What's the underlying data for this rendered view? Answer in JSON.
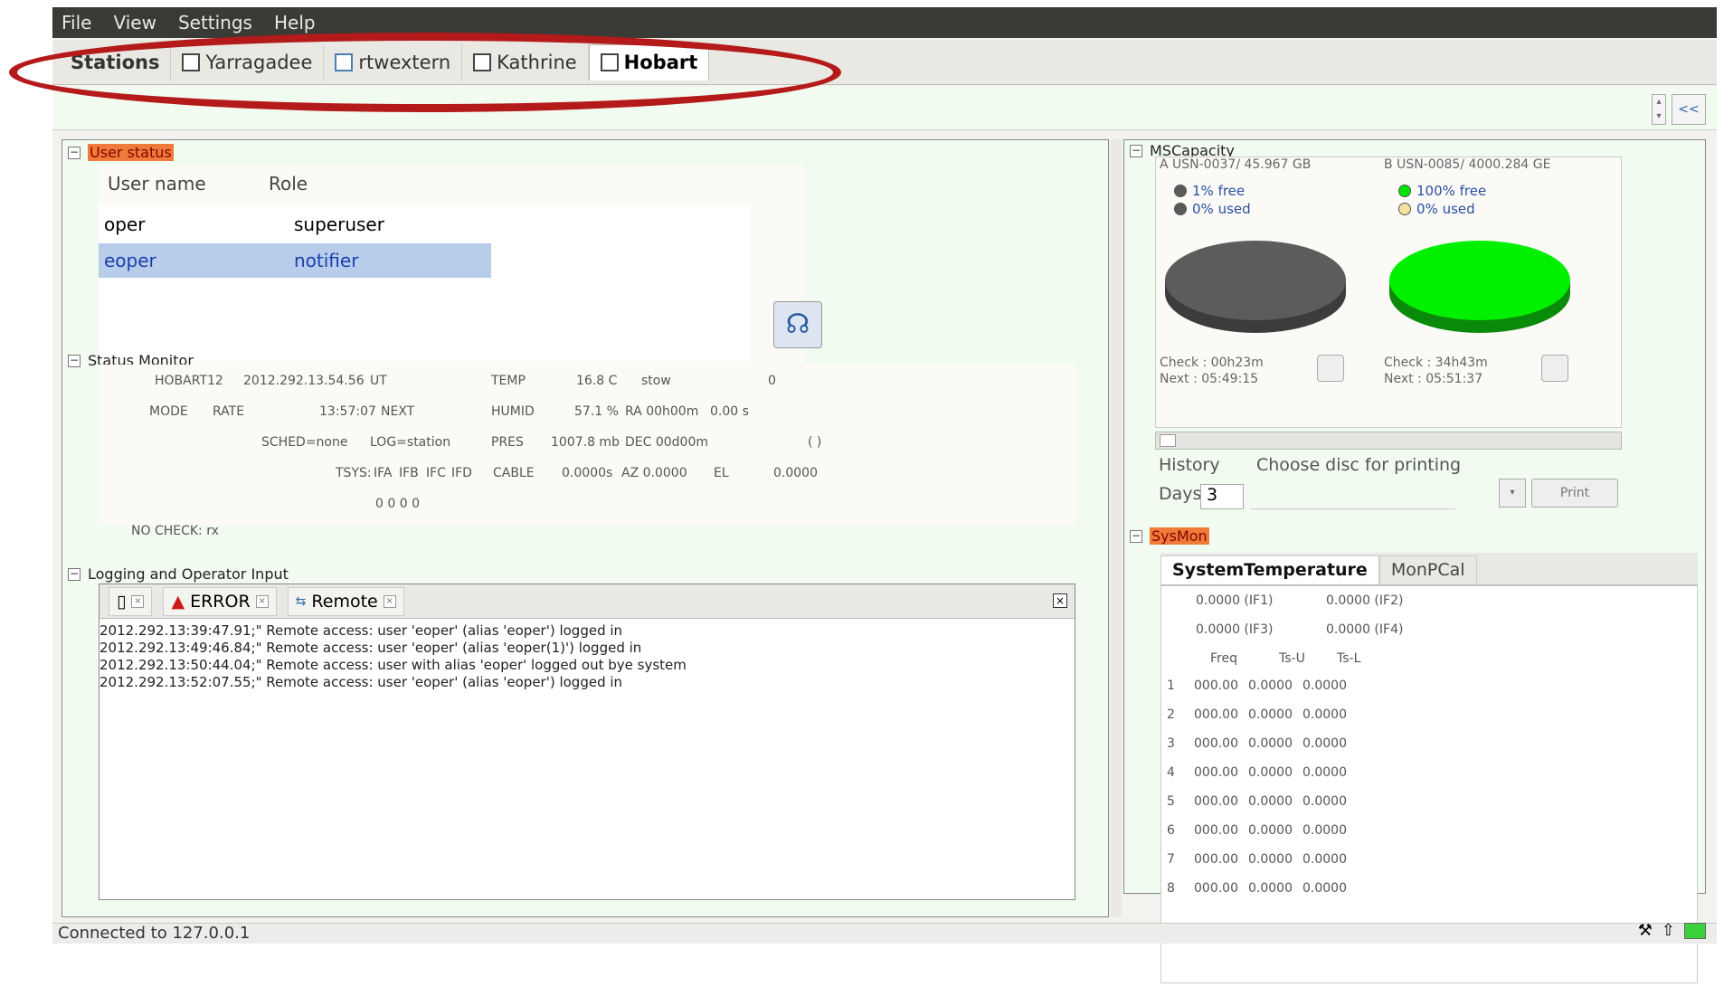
{
  "menu": [
    "File",
    "View",
    "Settings",
    "Help"
  ],
  "tabs": {
    "stations_label": "Stations",
    "stations": [
      "Yarragadee",
      "rtwextern",
      "Kathrine",
      "Hobart"
    ]
  },
  "strip": {
    "collapse_label": "<<"
  },
  "user_status": {
    "title": "User status",
    "col_name": "User name",
    "col_role": "Role",
    "rows": [
      {
        "name": "oper",
        "role": "superuser"
      },
      {
        "name": "eoper",
        "role": "notifier"
      }
    ]
  },
  "status_monitor": {
    "title": "Status Monitor",
    "station": "HOBART12",
    "datetime": "2012.292.13.54.56",
    "ut": "UT",
    "temp_label": "TEMP",
    "temp_value": "16.8 C",
    "stow": "stow",
    "zero": "0",
    "mode_label": "MODE",
    "rate_label": "RATE",
    "next_time": "13:57:07",
    "next_label": "NEXT",
    "humid_label": "HUMID",
    "humid_value": "57.1 %",
    "ra_value": "RA 00h00m",
    "ra_secs": "0.00 s",
    "sched": "SCHED=none",
    "log": "LOG=station",
    "pres_label": "PRES",
    "pres_value": "1007.8 mb",
    "dec_value": "DEC 00d00m",
    "paren": "(  )",
    "tsys": "TSYS:",
    "ifa": "IFA",
    "ifb": "IFB",
    "ifc": "IFC",
    "ifd": "IFD",
    "cable_label": "CABLE",
    "cable_value": "0.0000s",
    "az_value": "AZ  0.0000",
    "el_label": "EL",
    "el_value": "0.0000",
    "tsys_vals": "0   0   0   0",
    "nocheck": "NO CHECK: rx"
  },
  "logging": {
    "title": "Logging and Operator Input",
    "tab_error": "ERROR",
    "tab_remote": "Remote",
    "lines": [
      "2012.292.13:39:47.91;\" Remote access: user 'eoper' (alias 'eoper') logged in",
      "2012.292.13:49:46.84;\" Remote access: user 'eoper' (alias 'eoper(1)') logged in",
      "2012.292.13:50:44.04;\" Remote access: user with alias 'eoper' logged out bye system",
      "2012.292.13:52:07.55;\" Remote access: user 'eoper' (alias 'eoper') logged in"
    ]
  },
  "ms_capacity": {
    "title": "MSCapacity",
    "disk_a": {
      "header": "A USN-0037/  45.967 GB",
      "free_label": "1% free",
      "used_label": "0% used",
      "free_color": "#5a5a5a",
      "used_color": "#5a5a5a",
      "check": "Check : 00h23m",
      "next": "Next  : 05:49:15"
    },
    "disk_b": {
      "header": "B USN-0085/  4000.284 GE",
      "free_label": "100% free",
      "used_label": "0% used",
      "free_color": "#00e400",
      "used_color": "#f4e3a0",
      "check": "Check : 34h43m",
      "next": "Next  : 05:51:37"
    },
    "history": "History",
    "days_label": "Days :",
    "days_value": "3",
    "choose_disc": "Choose disc for printing",
    "print_label": "Print"
  },
  "sysmon": {
    "title": "SysMon",
    "tab1": "SystemTemperature",
    "tab2": "MonPCal",
    "if1": "0.0000  (IF1)",
    "if2": "0.0000  (IF2)",
    "if3": "0.0000  (IF3)",
    "if4": "0.0000  (IF4)",
    "col_freq": "Freq",
    "col_tsu": "Ts-U",
    "col_tsl": "Ts-L",
    "rows": [
      {
        "n": "1",
        "freq": "000.00",
        "tsu": "0.0000",
        "tsl": "0.0000"
      },
      {
        "n": "2",
        "freq": "000.00",
        "tsu": "0.0000",
        "tsl": "0.0000"
      },
      {
        "n": "3",
        "freq": "000.00",
        "tsu": "0.0000",
        "tsl": "0.0000"
      },
      {
        "n": "4",
        "freq": "000.00",
        "tsu": "0.0000",
        "tsl": "0.0000"
      },
      {
        "n": "5",
        "freq": "000.00",
        "tsu": "0.0000",
        "tsl": "0.0000"
      },
      {
        "n": "6",
        "freq": "000.00",
        "tsu": "0.0000",
        "tsl": "0.0000"
      },
      {
        "n": "7",
        "freq": "000.00",
        "tsu": "0.0000",
        "tsl": "0.0000"
      },
      {
        "n": "8",
        "freq": "000.00",
        "tsu": "0.0000",
        "tsl": "0.0000"
      }
    ]
  },
  "statusbar": {
    "text": "Connected to 127.0.0.1"
  }
}
